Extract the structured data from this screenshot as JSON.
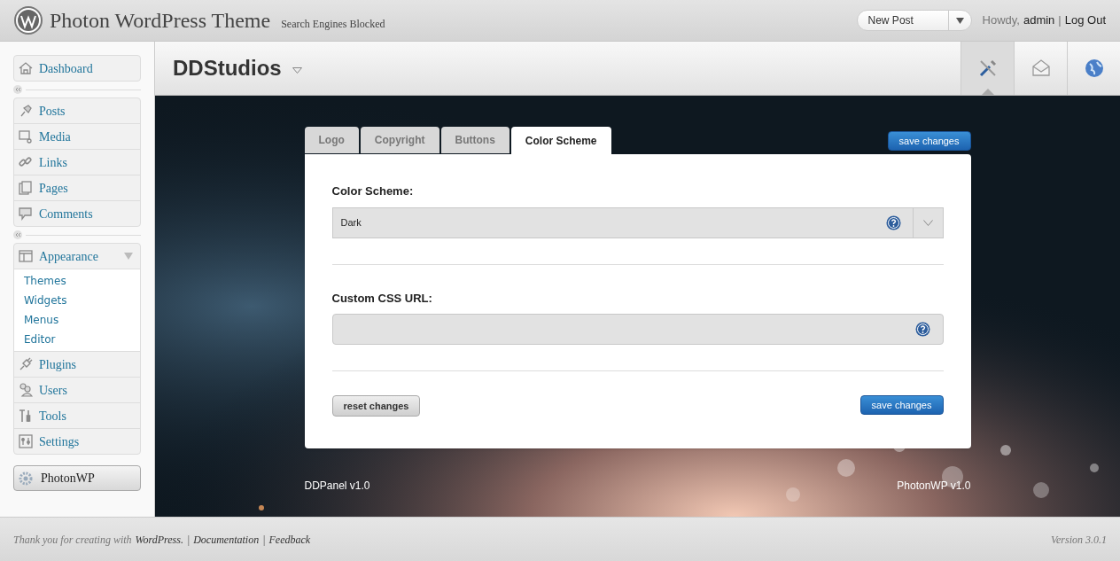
{
  "header": {
    "site_title": "Photon WordPress Theme",
    "note": "Search Engines Blocked",
    "new_post": "New Post",
    "greeting": "Howdy,",
    "user": "admin",
    "separator": "|",
    "logout": "Log Out"
  },
  "sidebar": {
    "groups": [
      {
        "items": [
          {
            "label": "Dashboard"
          }
        ]
      },
      {
        "items": [
          {
            "label": "Posts"
          },
          {
            "label": "Media"
          },
          {
            "label": "Links"
          },
          {
            "label": "Pages"
          },
          {
            "label": "Comments"
          }
        ]
      },
      {
        "items": [
          {
            "label": "Appearance",
            "expanded": true,
            "children": [
              {
                "label": "Themes"
              },
              {
                "label": "Widgets"
              },
              {
                "label": "Menus"
              },
              {
                "label": "Editor"
              }
            ]
          },
          {
            "label": "Plugins"
          },
          {
            "label": "Users"
          },
          {
            "label": "Tools"
          },
          {
            "label": "Settings"
          }
        ]
      }
    ],
    "plugin_button": "PhotonWP"
  },
  "topbar": {
    "site_name": "DDStudios",
    "tools": [
      {
        "selected": true
      },
      {
        "selected": false
      },
      {
        "selected": false
      }
    ]
  },
  "panel": {
    "tabs": [
      {
        "label": "Logo",
        "selected": false
      },
      {
        "label": "Copyright",
        "selected": false
      },
      {
        "label": "Buttons",
        "selected": false
      },
      {
        "label": "Color Scheme",
        "selected": true
      }
    ],
    "save_top": "save changes",
    "fields": [
      {
        "kind": "select",
        "label": "Color Scheme:",
        "value": "Dark"
      },
      {
        "kind": "text",
        "label": "Custom CSS URL:"
      }
    ],
    "reset": "reset changes",
    "save": "save changes"
  },
  "credits": {
    "left": "DDPanel v1.0",
    "right": "PhotonWP v1.0"
  },
  "footer": {
    "thanks": "Thank you for creating with",
    "wp_link": "WordPress.",
    "sep1": "|",
    "docs": "Documentation",
    "sep2": "|",
    "feedback": "Feedback",
    "version": "Version 3.0.1"
  }
}
